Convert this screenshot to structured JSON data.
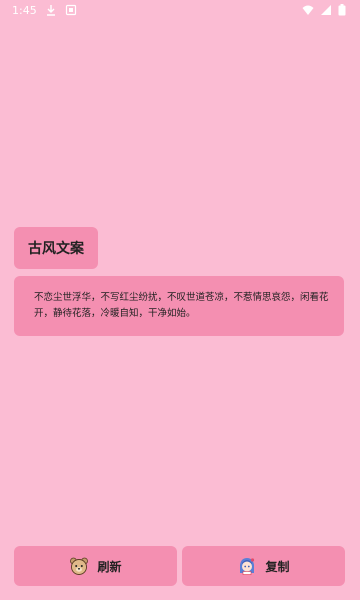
{
  "status_bar": {
    "time": "1:45",
    "icons": [
      "download-icon",
      "notification-icon",
      "wifi-icon",
      "signal-icon",
      "battery-icon"
    ]
  },
  "content": {
    "title": "古风文案",
    "quote": "不恋尘世浮华，不写红尘纷扰，不叹世道苍凉，不惹情思哀怨，闲看花开，静待花落，冷暖自知，干净如始。"
  },
  "buttons": {
    "refresh_label": "刷新",
    "refresh_icon": "bear-icon",
    "copy_label": "复制",
    "copy_icon": "anime-girl-icon"
  },
  "colors": {
    "background": "#FBBCD3",
    "card": "#F48FB1"
  }
}
